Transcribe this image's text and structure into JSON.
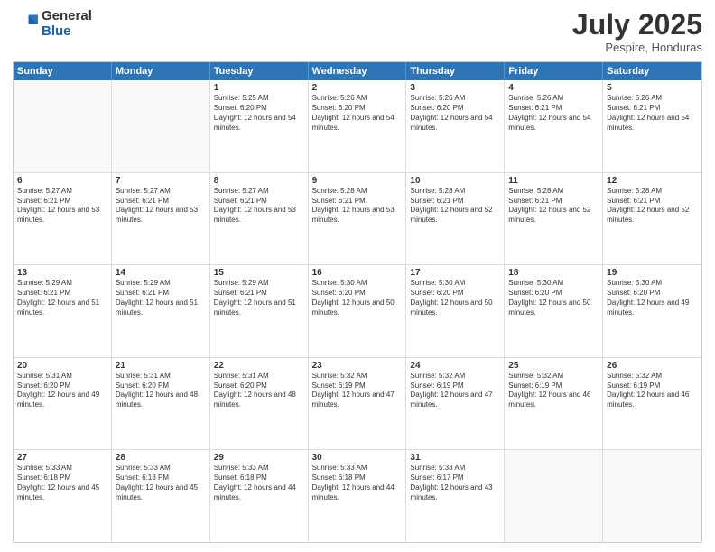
{
  "logo": {
    "general": "General",
    "blue": "Blue"
  },
  "header": {
    "month": "July 2025",
    "location": "Pespire, Honduras"
  },
  "weekdays": [
    "Sunday",
    "Monday",
    "Tuesday",
    "Wednesday",
    "Thursday",
    "Friday",
    "Saturday"
  ],
  "rows": [
    [
      {
        "day": "",
        "sunrise": "",
        "sunset": "",
        "daylight": ""
      },
      {
        "day": "",
        "sunrise": "",
        "sunset": "",
        "daylight": ""
      },
      {
        "day": "1",
        "sunrise": "Sunrise: 5:25 AM",
        "sunset": "Sunset: 6:20 PM",
        "daylight": "Daylight: 12 hours and 54 minutes."
      },
      {
        "day": "2",
        "sunrise": "Sunrise: 5:26 AM",
        "sunset": "Sunset: 6:20 PM",
        "daylight": "Daylight: 12 hours and 54 minutes."
      },
      {
        "day": "3",
        "sunrise": "Sunrise: 5:26 AM",
        "sunset": "Sunset: 6:20 PM",
        "daylight": "Daylight: 12 hours and 54 minutes."
      },
      {
        "day": "4",
        "sunrise": "Sunrise: 5:26 AM",
        "sunset": "Sunset: 6:21 PM",
        "daylight": "Daylight: 12 hours and 54 minutes."
      },
      {
        "day": "5",
        "sunrise": "Sunrise: 5:26 AM",
        "sunset": "Sunset: 6:21 PM",
        "daylight": "Daylight: 12 hours and 54 minutes."
      }
    ],
    [
      {
        "day": "6",
        "sunrise": "Sunrise: 5:27 AM",
        "sunset": "Sunset: 6:21 PM",
        "daylight": "Daylight: 12 hours and 53 minutes."
      },
      {
        "day": "7",
        "sunrise": "Sunrise: 5:27 AM",
        "sunset": "Sunset: 6:21 PM",
        "daylight": "Daylight: 12 hours and 53 minutes."
      },
      {
        "day": "8",
        "sunrise": "Sunrise: 5:27 AM",
        "sunset": "Sunset: 6:21 PM",
        "daylight": "Daylight: 12 hours and 53 minutes."
      },
      {
        "day": "9",
        "sunrise": "Sunrise: 5:28 AM",
        "sunset": "Sunset: 6:21 PM",
        "daylight": "Daylight: 12 hours and 53 minutes."
      },
      {
        "day": "10",
        "sunrise": "Sunrise: 5:28 AM",
        "sunset": "Sunset: 6:21 PM",
        "daylight": "Daylight: 12 hours and 52 minutes."
      },
      {
        "day": "11",
        "sunrise": "Sunrise: 5:28 AM",
        "sunset": "Sunset: 6:21 PM",
        "daylight": "Daylight: 12 hours and 52 minutes."
      },
      {
        "day": "12",
        "sunrise": "Sunrise: 5:28 AM",
        "sunset": "Sunset: 6:21 PM",
        "daylight": "Daylight: 12 hours and 52 minutes."
      }
    ],
    [
      {
        "day": "13",
        "sunrise": "Sunrise: 5:29 AM",
        "sunset": "Sunset: 6:21 PM",
        "daylight": "Daylight: 12 hours and 51 minutes."
      },
      {
        "day": "14",
        "sunrise": "Sunrise: 5:29 AM",
        "sunset": "Sunset: 6:21 PM",
        "daylight": "Daylight: 12 hours and 51 minutes."
      },
      {
        "day": "15",
        "sunrise": "Sunrise: 5:29 AM",
        "sunset": "Sunset: 6:21 PM",
        "daylight": "Daylight: 12 hours and 51 minutes."
      },
      {
        "day": "16",
        "sunrise": "Sunrise: 5:30 AM",
        "sunset": "Sunset: 6:20 PM",
        "daylight": "Daylight: 12 hours and 50 minutes."
      },
      {
        "day": "17",
        "sunrise": "Sunrise: 5:30 AM",
        "sunset": "Sunset: 6:20 PM",
        "daylight": "Daylight: 12 hours and 50 minutes."
      },
      {
        "day": "18",
        "sunrise": "Sunrise: 5:30 AM",
        "sunset": "Sunset: 6:20 PM",
        "daylight": "Daylight: 12 hours and 50 minutes."
      },
      {
        "day": "19",
        "sunrise": "Sunrise: 5:30 AM",
        "sunset": "Sunset: 6:20 PM",
        "daylight": "Daylight: 12 hours and 49 minutes."
      }
    ],
    [
      {
        "day": "20",
        "sunrise": "Sunrise: 5:31 AM",
        "sunset": "Sunset: 6:20 PM",
        "daylight": "Daylight: 12 hours and 49 minutes."
      },
      {
        "day": "21",
        "sunrise": "Sunrise: 5:31 AM",
        "sunset": "Sunset: 6:20 PM",
        "daylight": "Daylight: 12 hours and 48 minutes."
      },
      {
        "day": "22",
        "sunrise": "Sunrise: 5:31 AM",
        "sunset": "Sunset: 6:20 PM",
        "daylight": "Daylight: 12 hours and 48 minutes."
      },
      {
        "day": "23",
        "sunrise": "Sunrise: 5:32 AM",
        "sunset": "Sunset: 6:19 PM",
        "daylight": "Daylight: 12 hours and 47 minutes."
      },
      {
        "day": "24",
        "sunrise": "Sunrise: 5:32 AM",
        "sunset": "Sunset: 6:19 PM",
        "daylight": "Daylight: 12 hours and 47 minutes."
      },
      {
        "day": "25",
        "sunrise": "Sunrise: 5:32 AM",
        "sunset": "Sunset: 6:19 PM",
        "daylight": "Daylight: 12 hours and 46 minutes."
      },
      {
        "day": "26",
        "sunrise": "Sunrise: 5:32 AM",
        "sunset": "Sunset: 6:19 PM",
        "daylight": "Daylight: 12 hours and 46 minutes."
      }
    ],
    [
      {
        "day": "27",
        "sunrise": "Sunrise: 5:33 AM",
        "sunset": "Sunset: 6:18 PM",
        "daylight": "Daylight: 12 hours and 45 minutes."
      },
      {
        "day": "28",
        "sunrise": "Sunrise: 5:33 AM",
        "sunset": "Sunset: 6:18 PM",
        "daylight": "Daylight: 12 hours and 45 minutes."
      },
      {
        "day": "29",
        "sunrise": "Sunrise: 5:33 AM",
        "sunset": "Sunset: 6:18 PM",
        "daylight": "Daylight: 12 hours and 44 minutes."
      },
      {
        "day": "30",
        "sunrise": "Sunrise: 5:33 AM",
        "sunset": "Sunset: 6:18 PM",
        "daylight": "Daylight: 12 hours and 44 minutes."
      },
      {
        "day": "31",
        "sunrise": "Sunrise: 5:33 AM",
        "sunset": "Sunset: 6:17 PM",
        "daylight": "Daylight: 12 hours and 43 minutes."
      },
      {
        "day": "",
        "sunrise": "",
        "sunset": "",
        "daylight": ""
      },
      {
        "day": "",
        "sunrise": "",
        "sunset": "",
        "daylight": ""
      }
    ]
  ]
}
